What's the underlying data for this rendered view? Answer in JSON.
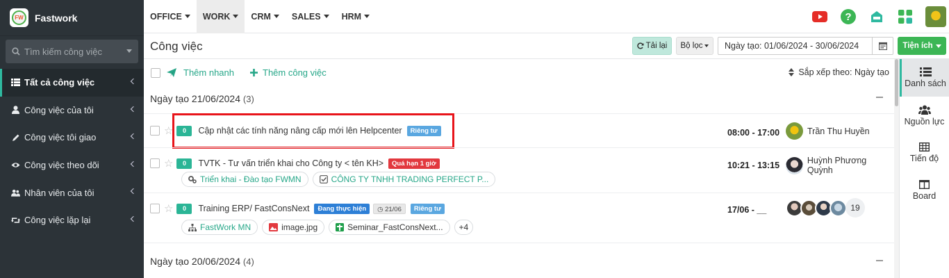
{
  "brand": {
    "name": "Fastwork",
    "logo_text": "FW"
  },
  "sidebar": {
    "search_placeholder": "Tìm kiếm công việc",
    "items": [
      {
        "label": "Tất cả công việc",
        "icon": "list-icon",
        "active": true
      },
      {
        "label": "Công việc của tôi",
        "icon": "user-icon"
      },
      {
        "label": "Công việc tôi giao",
        "icon": "pencil-icon"
      },
      {
        "label": "Công việc theo dõi",
        "icon": "eye-icon"
      },
      {
        "label": "Nhân viên của tôi",
        "icon": "users-icon"
      },
      {
        "label": "Công việc lặp lại",
        "icon": "retweet-icon"
      }
    ]
  },
  "topnav": {
    "items": [
      {
        "label": "OFFICE"
      },
      {
        "label": "WORK",
        "active": true
      },
      {
        "label": "CRM"
      },
      {
        "label": "SALES"
      },
      {
        "label": "HRM"
      }
    ],
    "icons": [
      "youtube-icon",
      "help-icon",
      "inbox-icon",
      "apps-grid-icon",
      "user-avatar"
    ]
  },
  "toolbar": {
    "title": "Công việc",
    "reload_label": "Tải lại",
    "filter_label": "Bộ lọc",
    "date_range": "Ngày tạo: 01/06/2024 - 30/06/2024",
    "utilities_label": "Tiện ích"
  },
  "actions": {
    "quick_add": "Thêm nhanh",
    "add_task": "Thêm công việc",
    "sort_label": "Sắp xếp theo: Ngày tạo"
  },
  "groups": [
    {
      "title": "Ngày tạo 21/06/2024",
      "count": "(3)"
    },
    {
      "title": "Ngày tạo 20/06/2024",
      "count": "(4)"
    }
  ],
  "tasks": [
    {
      "num": "0",
      "title": "Cập nhật các tính năng nâng cấp mới lên Helpcenter",
      "tag_private": "Riêng tư",
      "time": "08:00 - 17:00",
      "assignee": "Trần Thu Huyền"
    },
    {
      "num": "0",
      "title": "TVTK - Tư vấn triển khai cho Công ty < tên KH>",
      "tag_overdue": "Quá hạn 1 giờ",
      "time": "10:21 - 13:15",
      "assignee": "Huỳnh Phương Quỳnh",
      "chips": [
        "Triển khai - Đào tạo FWMN",
        "CÔNG TY TNHH TRADING PERFECT P..."
      ]
    },
    {
      "num": "0",
      "title": "Training ERP/ FastConsNext",
      "tag_progress": "Đang thực hiện",
      "tag_date": "21/06",
      "tag_private": "Riêng tư",
      "time": "17/06 - __",
      "assignee_count": "19",
      "chips": [
        "FastWork MN",
        "image.jpg",
        "Seminar_FastConsNext...",
        "+4"
      ]
    }
  ],
  "views": [
    {
      "label": "Danh sách",
      "icon": "list-view-icon",
      "active": true
    },
    {
      "label": "Nguồn lực",
      "icon": "users-icon"
    },
    {
      "label": "Tiến độ",
      "icon": "table-icon"
    },
    {
      "label": "Board",
      "icon": "columns-icon"
    }
  ],
  "colors": {
    "sidebar": "#2c3338",
    "accent": "#2fb9a0",
    "success": "#3cb655",
    "danger": "#e2383e",
    "info": "#5aa7e0"
  }
}
